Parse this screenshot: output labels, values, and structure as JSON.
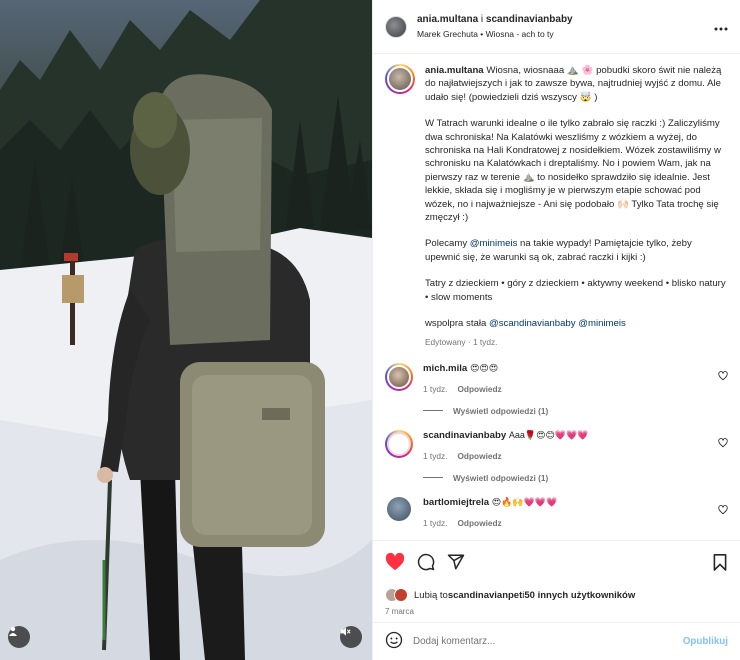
{
  "header": {
    "user": "ania.multana",
    "conjunction": " i ",
    "collab": "scandinavianbaby",
    "song": "Marek Grechuta • Wiosna - ach to ty",
    "more_icon": "more-horizontal-icon"
  },
  "caption": {
    "user": "ania.multana",
    "p1": "Wiosna, wiosnaaa ⛰️ 🌸 pobudki skoro świt nie należą do najłatwiejszych i jak to zawsze bywa, najtrudniej wyjść z domu. Ale udało się! (powiedzieli dziś wszyscy 🤯 )",
    "p2": "W Tatrach warunki idealne o ile tylko zabrało się raczki :) Zaliczyliśmy dwa schroniska! Na Kalatówki weszliśmy z wózkiem a wyżej, do schroniska na Hali Kondratowej z nosidełkiem. Wózek zostawiliśmy w schronisku na Kalatówkach i dreptaliśmy. No i powiem Wam, jak na pierwszy raz w terenie ⛰️ to nosidełko sprawdziło się idealnie. Jest lekkie, składa się i mogliśmy je w pierwszym etapie schować pod wózek, no i najważniejsze - Ani się podobało 🙌🏻 Tylko Tata trochę się zmęczył :)",
    "p3a": "Polecamy ",
    "p3_link": "@minimeis",
    "p3b": " na takie wypady! Pamiętajcie tylko, żeby upewnić się, że warunki są ok, zabrać raczki i kijki :)",
    "p4": "Tatry z dzieckiem • góry z dzieckiem • aktywny weekend • blisko natury • slow moments",
    "p5a": "wspolpra stała ",
    "p5_link1": "@scandinavianbaby",
    "p5_link2": "@minimeis",
    "meta": "Edytowany · 1 tydz."
  },
  "comments": [
    {
      "user": "mich.mila",
      "text": "😍😍😍",
      "time": "1 tydz.",
      "reply": "Odpowiedz",
      "view": "Wyświetl odpowiedzi (1)"
    },
    {
      "user": "scandinavianbaby",
      "text": "Aaa🌹😍😊💗💗💗",
      "time": "1 tydz.",
      "reply": "Odpowiedz",
      "view": "Wyświetl odpowiedzi (1)"
    },
    {
      "user": "bartlomiejtrela",
      "text": "😍🔥🙌💗💗💗",
      "time": "1 tydz.",
      "reply": "Odpowiedz"
    }
  ],
  "actions": {
    "like_icon": "heart-filled-icon",
    "comment_icon": "comment-icon",
    "share_icon": "send-icon",
    "save_icon": "bookmark-icon",
    "like_color": "#ff3040"
  },
  "likes": {
    "prefix": "Lubią to ",
    "first": "scandinavianpet",
    "mid": " i ",
    "rest": "50 innych użytkowników"
  },
  "date": "7 marca",
  "composer": {
    "placeholder": "Dodaj komentarz...",
    "publish": "Opublikuj",
    "emoji_icon": "smiley-icon"
  },
  "photo": {
    "user_icon": "person-icon",
    "mute_icon": "speaker-muted-icon"
  },
  "colors": {
    "link": "#00376b",
    "muted": "#737373",
    "publish": "#84c2f4"
  }
}
